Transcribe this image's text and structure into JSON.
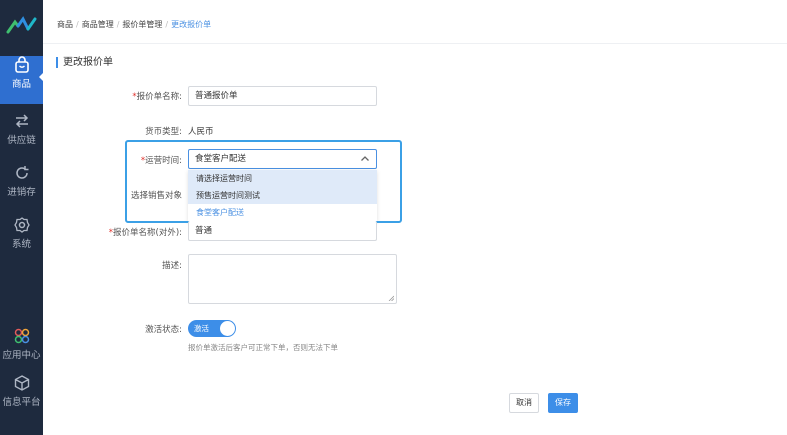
{
  "sidebar": {
    "items": [
      {
        "label": "商品",
        "icon": "shopping-bag-icon",
        "active": true
      },
      {
        "label": "供应链",
        "icon": "exchange-arrows-icon"
      },
      {
        "label": "进销存",
        "icon": "refresh-cycle-icon"
      },
      {
        "label": "系统",
        "icon": "gear-icon"
      },
      {
        "label": "应用中心",
        "icon": "apps-icon"
      },
      {
        "label": "信息平台",
        "icon": "cube-icon"
      }
    ]
  },
  "breadcrumb": [
    "商品",
    "商品管理",
    "报价单管理",
    "更改报价单"
  ],
  "section_title": "更改报价单",
  "form": {
    "name_label": "报价单名称",
    "name_value": "普通报价单",
    "currency_label": "货币类型:",
    "currency_value": "人民币",
    "shipping_label": "运营时间:",
    "shipping_value": "食堂客户配送",
    "shipping_options": [
      "请选择运营时间",
      "预售运营时间测试",
      "食堂客户配送"
    ],
    "sales_target_label": "选择销售对象",
    "external_name_label": "报价单名称(对外):",
    "external_name_value": "普通",
    "desc_label": "描述:",
    "active_label": "激活状态:",
    "active_toggle_text": "激活",
    "active_hint": "报价单激活后客户可正常下单，否则无法下单"
  },
  "buttons": {
    "cancel": "取消",
    "save": "保存"
  },
  "colors": {
    "accent": "#3d8ee8",
    "sidebar_bg": "#1e2a3e",
    "required": "#e0302a"
  }
}
